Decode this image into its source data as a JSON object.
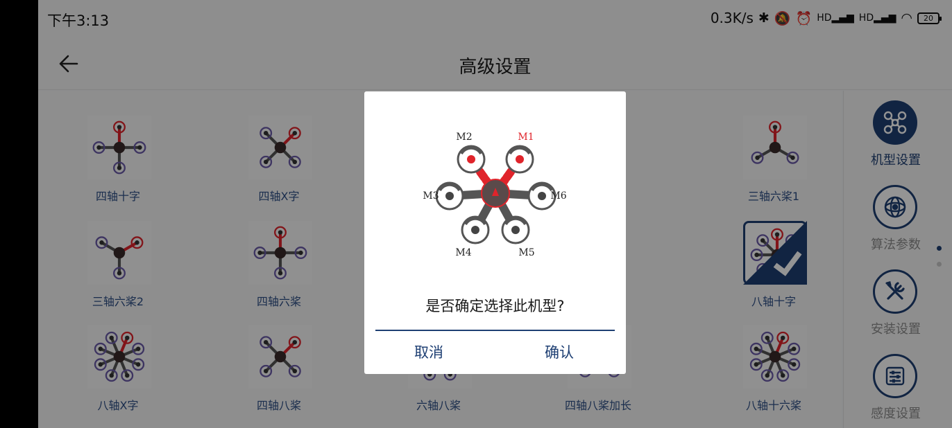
{
  "status_bar": {
    "time": "下午3:13",
    "net_speed": "0.3K/s",
    "icons": [
      "bluetooth-icon",
      "mute-icon",
      "alarm-icon",
      "signal-hd-1-icon",
      "signal-hd-2-icon",
      "wifi-icon"
    ],
    "battery": "20"
  },
  "header": {
    "title": "高级设置"
  },
  "grid": {
    "items": [
      {
        "label": "四轴十字"
      },
      {
        "label": "四轴X字"
      },
      {
        "label": "三轴六桨1"
      },
      {
        "label": "三轴六桨2"
      },
      {
        "label": "四轴六桨"
      },
      {
        "label": "八轴十字",
        "selected": true
      },
      {
        "label": "八轴X字"
      },
      {
        "label": "四轴八桨"
      },
      {
        "label": "六轴八桨"
      },
      {
        "label": "四轴八桨加长"
      },
      {
        "label": "八轴十六桨"
      }
    ]
  },
  "sidebar": {
    "items": [
      {
        "label": "机型设置",
        "icon": "drone-icon",
        "active": true
      },
      {
        "label": "算法参数",
        "icon": "gyro-icon"
      },
      {
        "label": "安装设置",
        "icon": "tools-icon"
      },
      {
        "label": "感度设置",
        "icon": "sliders-icon"
      }
    ]
  },
  "dialog": {
    "motor_labels": [
      "M1",
      "M2",
      "M3",
      "M4",
      "M5",
      "M6"
    ],
    "message": "是否确定选择此机型?",
    "cancel": "取消",
    "confirm": "确认"
  },
  "colors": {
    "accent": "#1e3f73",
    "motor_front": "#e0242b",
    "frame": "#555555"
  }
}
